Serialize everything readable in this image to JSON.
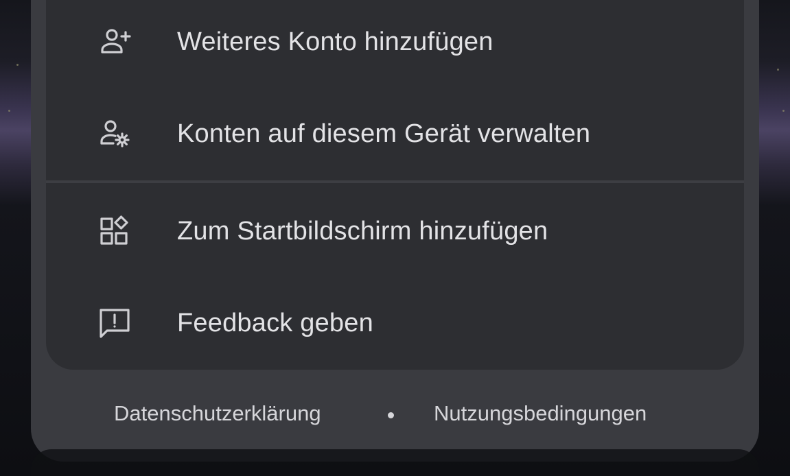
{
  "menu": {
    "items": [
      {
        "label": "Weiteres Konto hinzufügen",
        "icon": "person-add-icon"
      },
      {
        "label": "Konten auf diesem Gerät verwalten",
        "icon": "manage-accounts-icon"
      },
      {
        "label": "Zum Startbildschirm hinzufügen",
        "icon": "add-to-home-screen-icon"
      },
      {
        "label": "Feedback geben",
        "icon": "feedback-icon"
      }
    ]
  },
  "footer": {
    "privacy_label": "Datenschutzerklärung",
    "separator": "•",
    "terms_label": "Nutzungsbedingungen"
  },
  "colors": {
    "sheet_background": "#3a3b40",
    "card_background": "#2d2e32",
    "text_primary": "#e3e3e6"
  }
}
